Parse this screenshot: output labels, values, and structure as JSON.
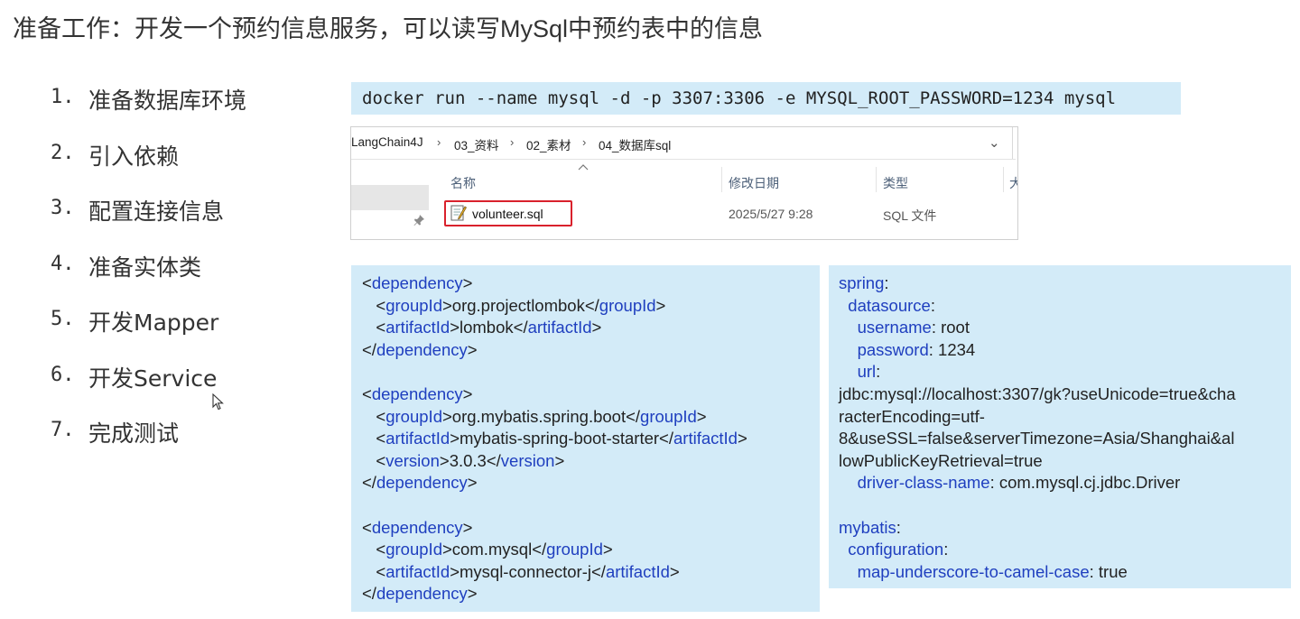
{
  "title": "准备工作：开发一个预约信息服务，可以读写MySql中预约表中的信息",
  "steps": [
    {
      "num": "1.",
      "text": "准备数据库环境"
    },
    {
      "num": "2.",
      "text": "引入依赖"
    },
    {
      "num": "3.",
      "text": "配置连接信息"
    },
    {
      "num": "4.",
      "text": "准备实体类"
    },
    {
      "num": "5.",
      "text": "开发Mapper"
    },
    {
      "num": "6.",
      "text": "开发Service"
    },
    {
      "num": "7.",
      "text": "完成测试"
    }
  ],
  "command": "docker run --name mysql -d -p 3307:3306 -e MYSQL_ROOT_PASSWORD=1234 mysql",
  "explorer": {
    "breadcrumb": [
      "LangChain4J",
      "03_资料",
      "02_素材",
      "04_数据库sql"
    ],
    "breadcrumb_sep": "›",
    "dropdown": "⌄",
    "columns": {
      "name": "名称",
      "modified": "修改日期",
      "type": "类型",
      "size_partial": "大"
    },
    "file": {
      "name": "volunteer.sql",
      "date": "2025/5/27 9:28",
      "type": "SQL 文件"
    }
  },
  "pom": {
    "dep_open": "<dependency>",
    "dep_close": "</dependency>",
    "dep1": {
      "groupId": "org.projectlombok",
      "artifactId": "lombok"
    },
    "dep2": {
      "groupId": "org.mybatis.spring.boot",
      "artifactId": "mybatis-spring-boot-starter",
      "version": "3.0.3"
    },
    "dep3": {
      "groupId": "com.mysql",
      "artifactId": "mysql-connector-j"
    }
  },
  "yml": {
    "spring": "spring",
    "datasource": "datasource",
    "username_key": "username",
    "username_val": " root",
    "password_key": "password",
    "password_val": " 1234",
    "url_key": "url",
    "url_lines": [
      "jdbc:mysql://localhost:3307/gk?useUnicode=true&cha",
      "racterEncoding=utf-",
      "8&useSSL=false&serverTimezone=Asia/Shanghai&al",
      "lowPublicKeyRetrieval=true"
    ],
    "driver_key": "driver-class-name",
    "driver_val": " com.mysql.cj.jdbc.Driver",
    "mybatis": "mybatis",
    "configuration": "configuration",
    "m2c_key": "map-underscore-to-camel-case",
    "m2c_val": " true"
  },
  "colors": {
    "code_bg": "#d3ebf8",
    "tag": "#1f3fbf",
    "highlight": "#d9212c"
  }
}
